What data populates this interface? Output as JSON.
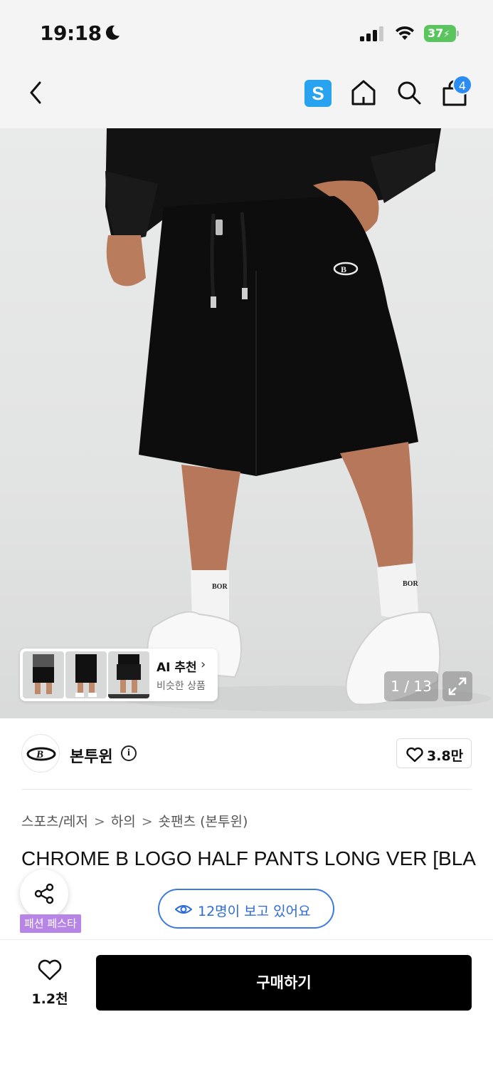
{
  "status_bar": {
    "time": "19:18",
    "battery": "37"
  },
  "nav": {
    "store_badge": "S",
    "cart_count": "4"
  },
  "gallery": {
    "ai_title": "AI 추천",
    "ai_subtitle": "비슷한 상품",
    "counter": "1 / 13"
  },
  "brand": {
    "name": "본투윈",
    "info_symbol": "i",
    "like_count": "3.8만"
  },
  "breadcrumb": [
    "스포츠/레저",
    "하의",
    "숏팬츠 (본투윈)"
  ],
  "breadcrumb_separator": ">",
  "product": {
    "title": "CHROME B LOGO HALF PANTS LONG VER [BLACK]",
    "tag": "패션 페스타"
  },
  "viewers": {
    "label": "12명이 보고 있어요"
  },
  "bottom_bar": {
    "wish_count": "1.2천",
    "buy_label": "구매하기"
  },
  "colors": {
    "accent_blue": "#2d6ad6",
    "store_badge_blue": "#29a3ef",
    "tag_purple": "#b785e6",
    "battery_green": "#5ac45f",
    "buy_button": "#000000"
  }
}
